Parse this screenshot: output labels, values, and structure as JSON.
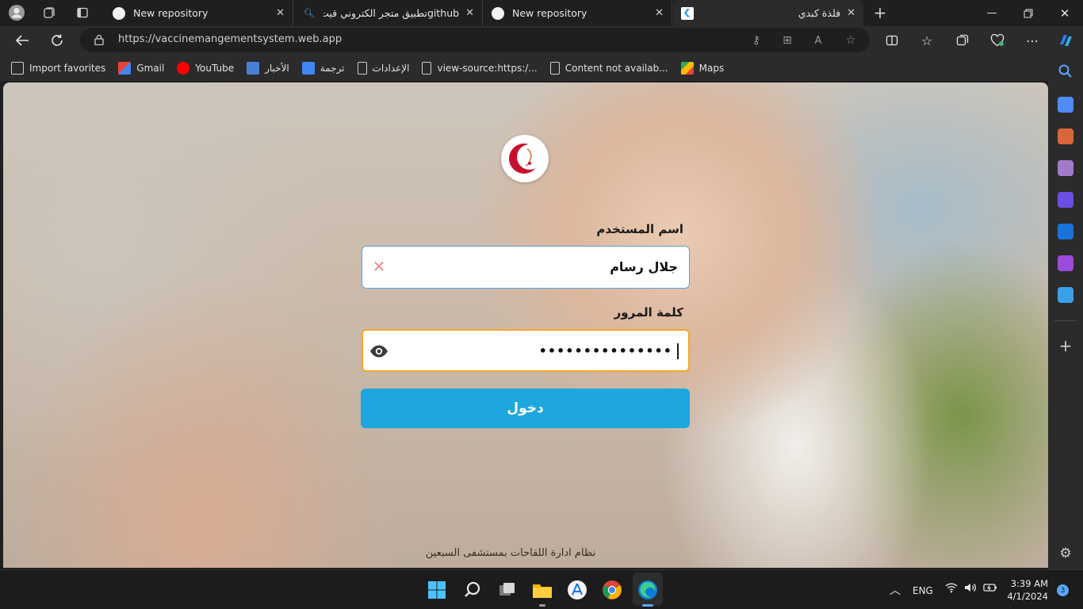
{
  "browser": {
    "tabs": [
      {
        "title": "New repository",
        "icon": "github-icon"
      },
      {
        "title": "githubتطبيق متجر الكتروني قيت هب",
        "icon": "search-icon"
      },
      {
        "title": "New repository",
        "icon": "github-icon"
      },
      {
        "title": "فلذة كبدي",
        "icon": "flutter-icon"
      }
    ],
    "new_tab_glyph": "+",
    "url": "https://vaccinemangementsystem.web.app",
    "bookmarks": [
      {
        "label": "Import favorites",
        "icon": "import-icon"
      },
      {
        "label": "Gmail",
        "icon": "gmail-icon"
      },
      {
        "label": "YouTube",
        "icon": "youtube-icon"
      },
      {
        "label": "الأخبار",
        "icon": "news-icon"
      },
      {
        "label": "ترجمة",
        "icon": "translate-icon"
      },
      {
        "label": "الإعدادات",
        "icon": "page-icon"
      },
      {
        "label": "view-source:https:/...",
        "icon": "page-icon"
      },
      {
        "label": "Content not availab...",
        "icon": "page-icon"
      },
      {
        "label": "Maps",
        "icon": "maps-icon"
      }
    ]
  },
  "login": {
    "username_label": "اسم المستخدم",
    "username_value": "جلال رسام",
    "password_label": "كلمة المرور",
    "password_value": "•••••••••••••••",
    "submit_label": "دخول",
    "footer": "نظام ادارة اللقاحات بمستشفى السبعين"
  },
  "taskbar": {
    "language": "ENG",
    "time": "3:39 AM",
    "date": "4/1/2024",
    "notifications": "3"
  },
  "colors": {
    "accent_button": "#1ea7df",
    "password_focus_border": "#f5a623",
    "username_border": "#5aa3e0",
    "logo_red": "#c8102e"
  }
}
